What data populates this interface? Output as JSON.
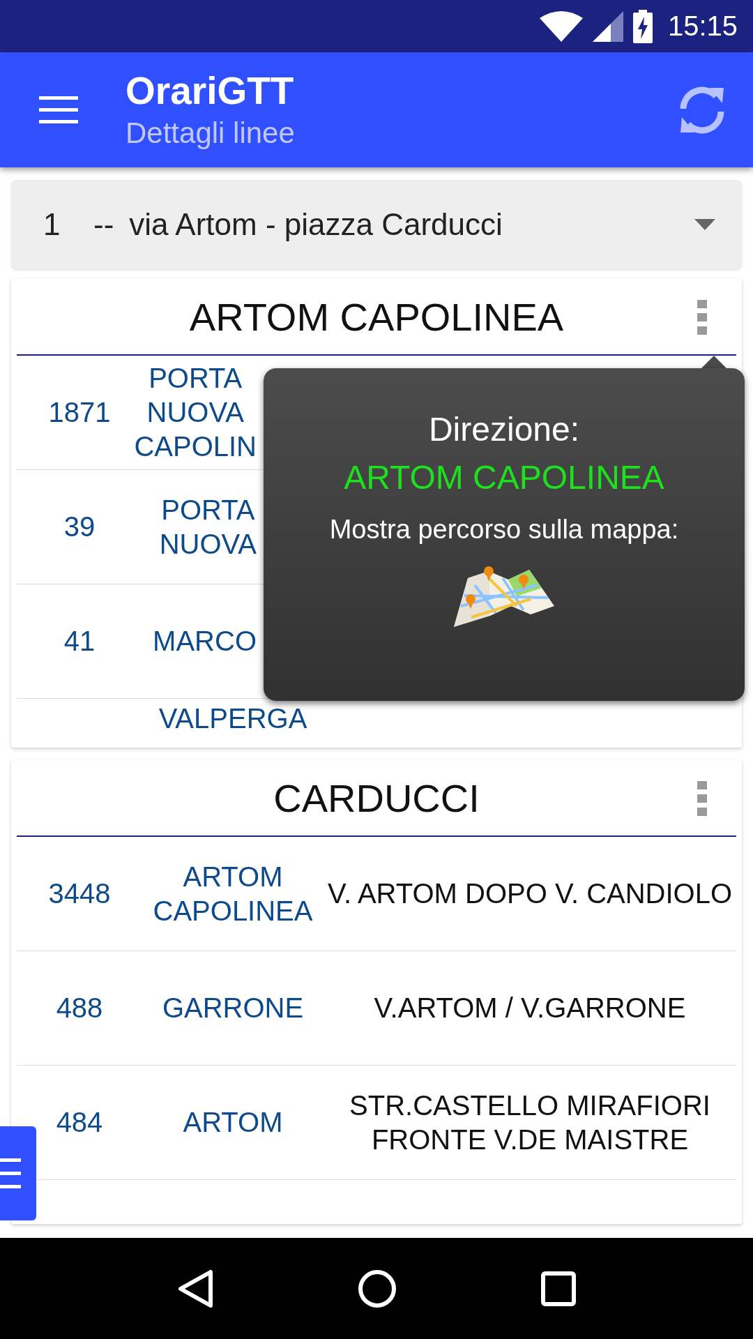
{
  "status_bar": {
    "time": "15:15"
  },
  "app_bar": {
    "title": "OrariGTT",
    "subtitle": "Dettagli linee"
  },
  "line_selector": {
    "number": "1",
    "separator": "--",
    "name": "via Artom - piazza Carducci"
  },
  "directions": [
    {
      "title": "ARTOM CAPOLINEA",
      "clipped": true,
      "stops": [
        {
          "code": "1871",
          "line": "PORTA\nNUOVA\nCAPOLIN"
        },
        {
          "code": "39",
          "line": "PORTA\nNUOVA"
        },
        {
          "code": "41",
          "line": "MARCO"
        },
        {
          "line": "VALPERGA"
        }
      ]
    },
    {
      "title": "CARDUCCI",
      "clipped": false,
      "stops": [
        {
          "code": "3448",
          "line": "ARTOM\nCAPOLINEA",
          "name": "V. ARTOM DOPO V. CANDIOLO"
        },
        {
          "code": "488",
          "line": "GARRONE",
          "name": "V.ARTOM / V.GARRONE"
        },
        {
          "code": "484",
          "line": "ARTOM",
          "name": "STR.CASTELLO MIRAFIORI\nFRONTE V.DE MAISTRE"
        }
      ]
    }
  ],
  "popup": {
    "label": "Direzione:",
    "direction": "ARTOM CAPOLINEA",
    "map_prompt": "Mostra percorso sulla mappa:"
  }
}
